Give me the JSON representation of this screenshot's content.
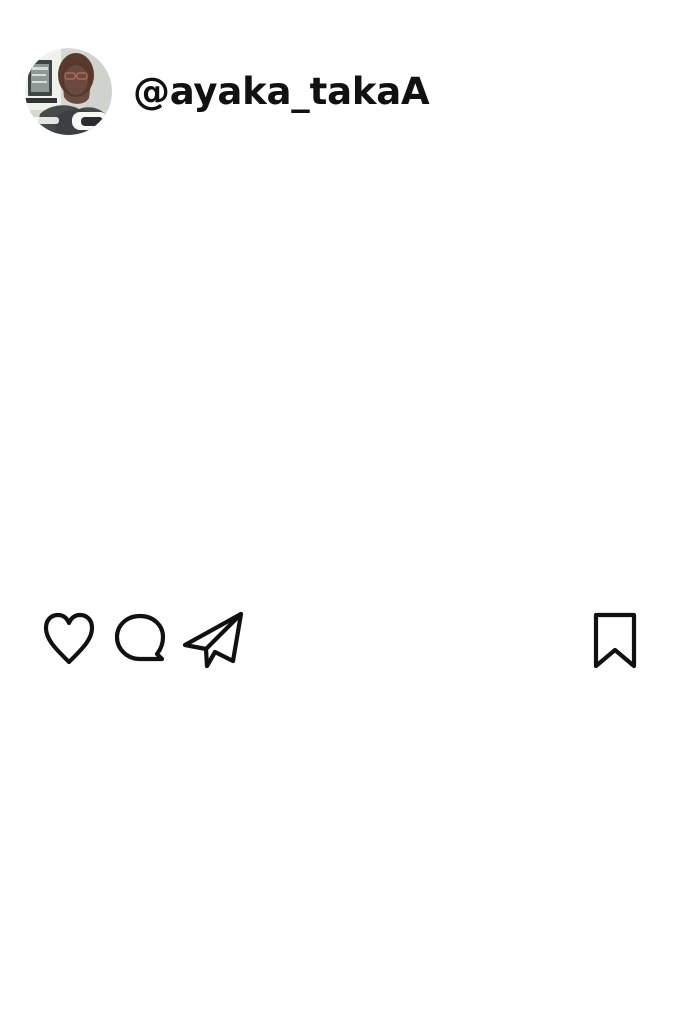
{
  "post": {
    "author": {
      "username": "@ayaka_takaA",
      "avatar_icon": "profile-photo"
    },
    "actions": {
      "like_icon": "heart-outline-icon",
      "comment_icon": "speech-bubble-icon",
      "share_icon": "paper-plane-icon",
      "save_icon": "bookmark-outline-icon"
    }
  },
  "colors": {
    "background": "#ffffff",
    "text": "#111111",
    "icon_stroke": "#111111"
  }
}
